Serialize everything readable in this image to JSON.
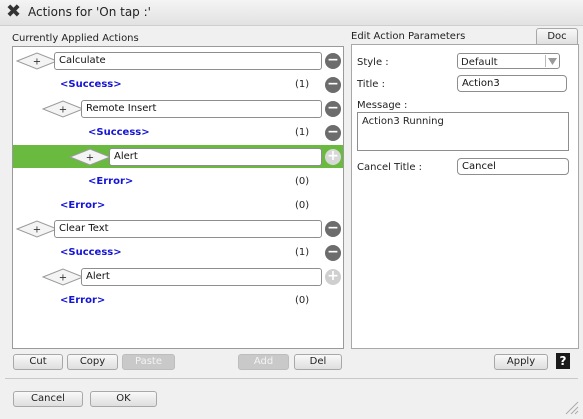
{
  "window": {
    "title": "Actions for 'On tap :'"
  },
  "left": {
    "header": "Currently Applied Actions",
    "rows": [
      {
        "label": "Calculate",
        "success": "<Success>",
        "success_count": "(1)"
      },
      {
        "label": "Remote Insert",
        "success": "<Success>",
        "success_count": "(1)"
      },
      {
        "label": "Alert",
        "error": "<Error>",
        "error_count": "(0)"
      },
      {
        "label": "Clear Text"
      },
      {
        "label": "Alert"
      }
    ],
    "error_label": "<Error>",
    "success_label": "<Success>",
    "counts": [
      "(1)",
      "(1)",
      "(0)",
      "(0)",
      "(1)",
      "(0)"
    ]
  },
  "toolbar": {
    "cut": "Cut",
    "copy": "Copy",
    "paste": "Paste",
    "add": "Add",
    "del": "Del"
  },
  "right": {
    "header": "Edit Action Parameters",
    "doc_tab": "Doc",
    "style_label": "Style :",
    "style_value": "Default",
    "title_label": "Title :",
    "title_value": "Action3",
    "message_label": "Message :",
    "message_value": "Action3 Running",
    "cancel_title_label": "Cancel Title :",
    "cancel_title_value": "Cancel",
    "apply": "Apply",
    "help": "?"
  },
  "footer": {
    "cancel": "Cancel",
    "ok": "OK"
  },
  "colors": {
    "selection": "#6aba3f",
    "blue_text": "#1414d8"
  }
}
